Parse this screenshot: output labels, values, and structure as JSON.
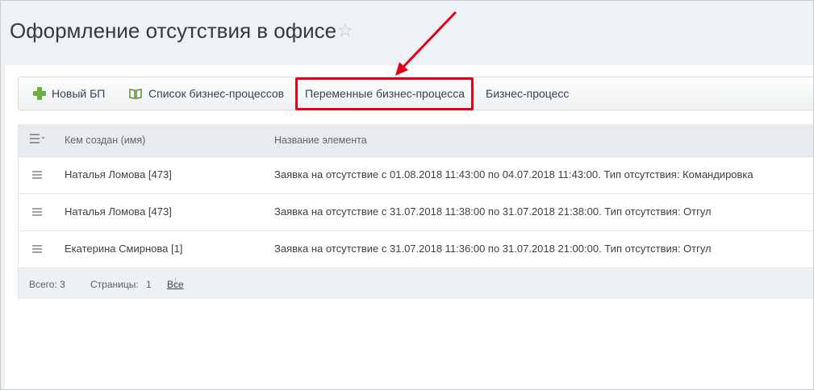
{
  "page": {
    "title": "Оформление отсутствия в офисе",
    "star_icon": "star-outline-icon"
  },
  "toolbar": {
    "items": [
      {
        "label": "Новый БП",
        "icon": "plus-icon",
        "icon_color": "#6ab03b"
      },
      {
        "label": "Список бизнес-процессов",
        "icon": "book-icon"
      },
      {
        "label": "Переменные бизнес-процесса",
        "highlighted": true
      },
      {
        "label": "Бизнес-процесс"
      }
    ]
  },
  "grid": {
    "settings_icon": "list-settings-icon",
    "columns": [
      "Кем создан (имя)",
      "Название элемента"
    ],
    "rows": [
      {
        "author": "Наталья Ломова [473]",
        "name": "Заявка на отсутствие с 01.08.2018 11:43:00 по 04.07.2018 11:43:00. Тип отсутствия: Командировка"
      },
      {
        "author": "Наталья Ломова [473]",
        "name": "Заявка на отсутствие с 31.07.2018 11:38:00 по 31.07.2018 21:38:00. Тип отсутствия: Отгул"
      },
      {
        "author": "Екатерина Смирнова [1]",
        "name": "Заявка на отсутствие с 31.07.2018 11:36:00 по 31.07.2018 21:00:00. Тип отсутствия: Отгул"
      }
    ],
    "footer": {
      "total_label": "Всего: 3",
      "pages_label": "Страницы:",
      "page_number": "1",
      "all_link": "Все"
    }
  },
  "annotation": {
    "highlight_color": "#e2001a"
  }
}
